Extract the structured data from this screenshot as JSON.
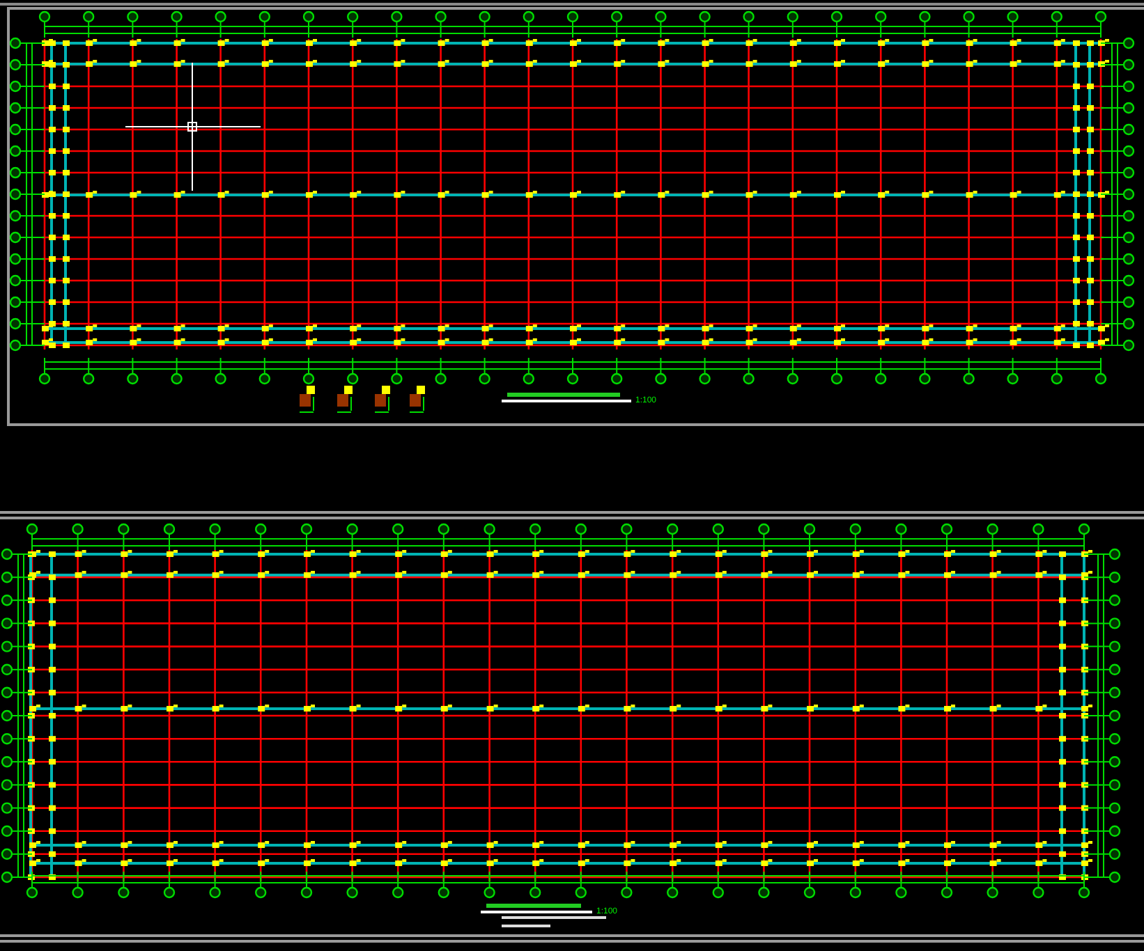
{
  "sheets": [
    {
      "scale": "1:100"
    },
    {
      "scale": "1:100"
    }
  ]
}
